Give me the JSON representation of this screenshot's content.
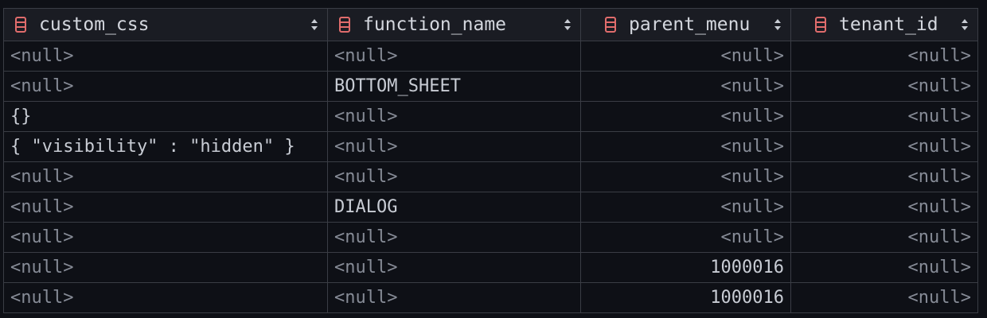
{
  "columns": [
    {
      "name": "custom_css",
      "align": "left"
    },
    {
      "name": "function_name",
      "align": "left"
    },
    {
      "name": "parent_menu",
      "align": "right"
    },
    {
      "name": "tenant_id",
      "align": "right"
    }
  ],
  "colors": {
    "column_icon": "#e06c6c",
    "null_text": "#868b96",
    "value_text": "#c8ccd4",
    "grid_line": "#3a3d45"
  },
  "rows": [
    [
      "<null>",
      "<null>",
      "<null>",
      "<null>"
    ],
    [
      "<null>",
      "BOTTOM_SHEET",
      "<null>",
      "<null>"
    ],
    [
      "{}",
      "<null>",
      "<null>",
      "<null>"
    ],
    [
      "{ \"visibility\" : \"hidden\" }",
      "<null>",
      "<null>",
      "<null>"
    ],
    [
      "<null>",
      "<null>",
      "<null>",
      "<null>"
    ],
    [
      "<null>",
      "DIALOG",
      "<null>",
      "<null>"
    ],
    [
      "<null>",
      "<null>",
      "<null>",
      "<null>"
    ],
    [
      "<null>",
      "<null>",
      "1000016",
      "<null>"
    ],
    [
      "<null>",
      "<null>",
      "1000016",
      "<null>"
    ]
  ]
}
